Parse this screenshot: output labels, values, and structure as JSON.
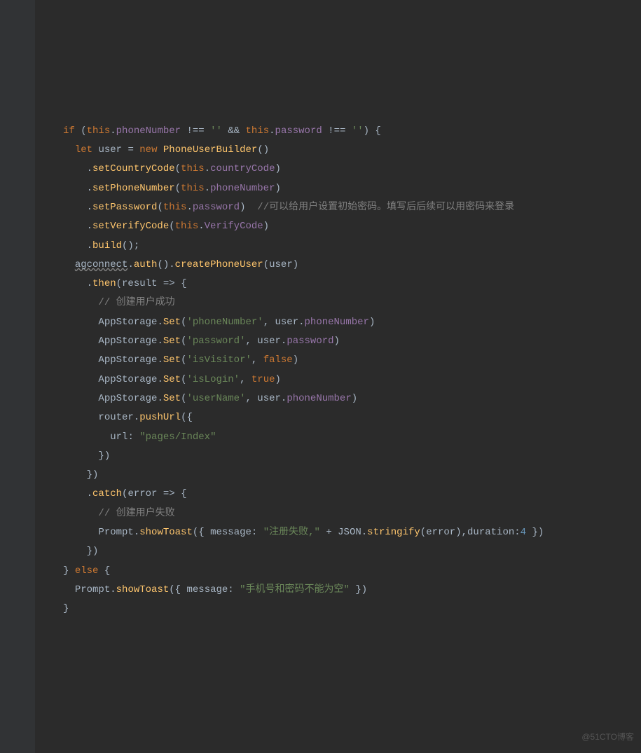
{
  "code": {
    "if": "if",
    "this": "this",
    "phoneNumber": "phoneNumber",
    "password": "password",
    "emptyStr": "''",
    "andOp": "&&",
    "neqOp": "!==",
    "let": "let",
    "user": "user",
    "eq": "=",
    "new": "new",
    "PhoneUserBuilder": "PhoneUserBuilder",
    "setCountryCode": "setCountryCode",
    "countryCode": "countryCode",
    "setPhoneNumber": "setPhoneNumber",
    "setPassword": "setPassword",
    "comment1": "//可以给用户设置初始密码。填写后后续可以用密码来登录",
    "setVerifyCode": "setVerifyCode",
    "VerifyCode": "VerifyCode",
    "build": "build",
    "agconnect": "agconnect",
    "auth": "auth",
    "createPhoneUser": "createPhoneUser",
    "then": "then",
    "result": "result",
    "arrow": "=>",
    "comment2": "// 创建用户成功",
    "AppStorage": "AppStorage",
    "Set": "Set",
    "strPhoneNumber": "'phoneNumber'",
    "strPassword": "'password'",
    "strIsVisitor": "'isVisitor'",
    "false": "false",
    "strIsLogin": "'isLogin'",
    "true": "true",
    "strUserName": "'userName'",
    "router": "router",
    "pushUrl": "pushUrl",
    "url": "url",
    "urlValue": "\"pages/Index\"",
    "catch": "catch",
    "error": "error",
    "comment3": "// 创建用户失败",
    "Prompt": "Prompt",
    "showToast": "showToast",
    "message": "message",
    "strRegFail": "\"注册失败,\"",
    "plus": "+",
    "JSON": "JSON",
    "stringify": "stringify",
    "duration": "duration",
    "four": "4",
    "else": "else",
    "strPhonePwdEmpty": "\"手机号和密码不能为空\""
  },
  "watermark": "@51CTO博客"
}
